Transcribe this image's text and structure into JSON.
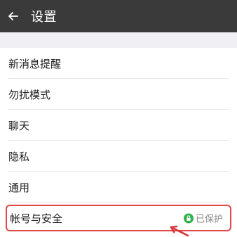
{
  "header": {
    "title": "设置",
    "back_icon": "back-arrow-icon"
  },
  "menu": {
    "items": [
      {
        "label": "新消息提醒"
      },
      {
        "label": "勿扰模式"
      },
      {
        "label": "聊天"
      },
      {
        "label": "隐私"
      },
      {
        "label": "通用"
      },
      {
        "label": "帐号与安全",
        "status": "已保护",
        "status_icon": "lock-icon",
        "highlighted": true
      }
    ]
  },
  "colors": {
    "titlebar": "#3a3a3a",
    "highlight_border": "#e04a4a",
    "status_icon": "#2fb24b"
  }
}
